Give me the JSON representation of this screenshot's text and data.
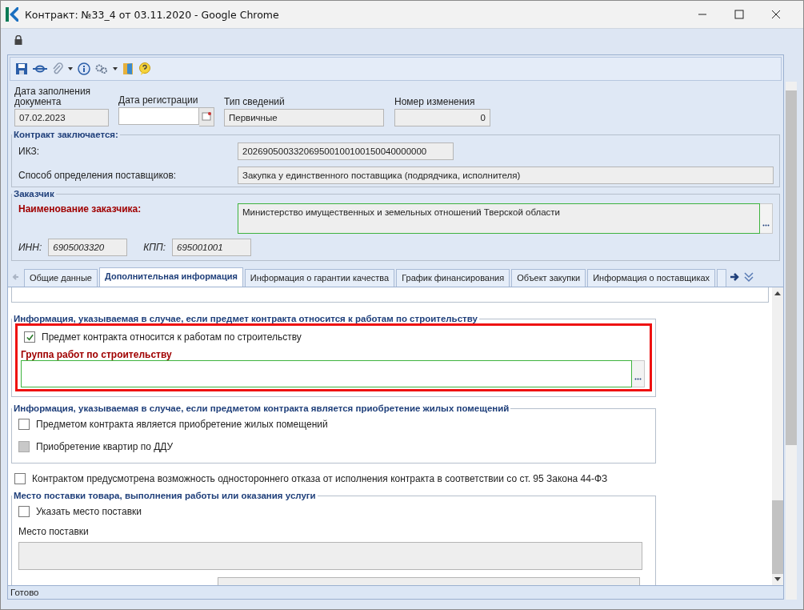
{
  "window": {
    "title": "Контракт: №33_4 от 03.11.2020 - Google Chrome"
  },
  "header_fields": [
    {
      "kind": "text",
      "label": "Дата заполнения документа",
      "value": "07.02.2023"
    },
    {
      "kind": "date",
      "label": "Дата регистрации"
    },
    {
      "kind": "text",
      "label": "Тип сведений",
      "value": "Первичные"
    },
    {
      "kind": "number",
      "label": "Номер изменения",
      "value": "0"
    }
  ],
  "contract_section": {
    "legend": "Контракт заключается:",
    "rows": [
      {
        "label": "ИКЗ:",
        "value": "202690500332069500100100150040000000",
        "wide": false
      },
      {
        "label": "Способ определения поставщиков:",
        "value": "Закупка у единственного поставщика (подрядчика, исполнителя)",
        "wide": true
      }
    ]
  },
  "customer": {
    "legend": "Заказчик",
    "name_label": "Наименование заказчика:",
    "name_value": "Министерство имущественных и земельных отношений Тверской области",
    "inn_label": "ИНН:",
    "inn_value": "6905003320",
    "kpp_label": "КПП:",
    "kpp_value": "695001001"
  },
  "tabs": [
    {
      "label": "Общие данные",
      "selected": false
    },
    {
      "label": "Дополнительная информация",
      "selected": true
    },
    {
      "label": "Информация о гарантии качества",
      "selected": false
    },
    {
      "label": "График финансирования",
      "selected": false
    },
    {
      "label": "Объект закупки",
      "selected": false
    },
    {
      "label": "Информация о поставщиках",
      "selected": false
    }
  ],
  "construction": {
    "legend": "Информация, указываемая в случае, если предмет контракта относится к работам по строительству",
    "checkbox": {
      "label": "Предмет контракта относится к работам по строительству",
      "checked": true
    },
    "group_label": "Группа работ по строительству"
  },
  "housing": {
    "legend": "Информация, указываемая в случае, если предметом контракта является приобретение жилых помещений",
    "items": [
      {
        "label": "Предметом контракта является приобретение жилых помещений",
        "checked": false,
        "disabled": false
      },
      {
        "label": "Приобретение квартир по ДДУ",
        "checked": false,
        "disabled": true
      }
    ]
  },
  "unilateral": {
    "label": "Контрактом предусмотрена возможность одностороннего отказа от исполнения контракта в соответствии со ст. 95 Закона 44-ФЗ",
    "checked": false
  },
  "delivery": {
    "legend": "Место поставки товара, выполнения работы или оказания услуги",
    "checkbox": {
      "label": "Указать место поставки",
      "checked": false
    },
    "place_label": "Место поставки"
  },
  "status_bar": "Готово"
}
